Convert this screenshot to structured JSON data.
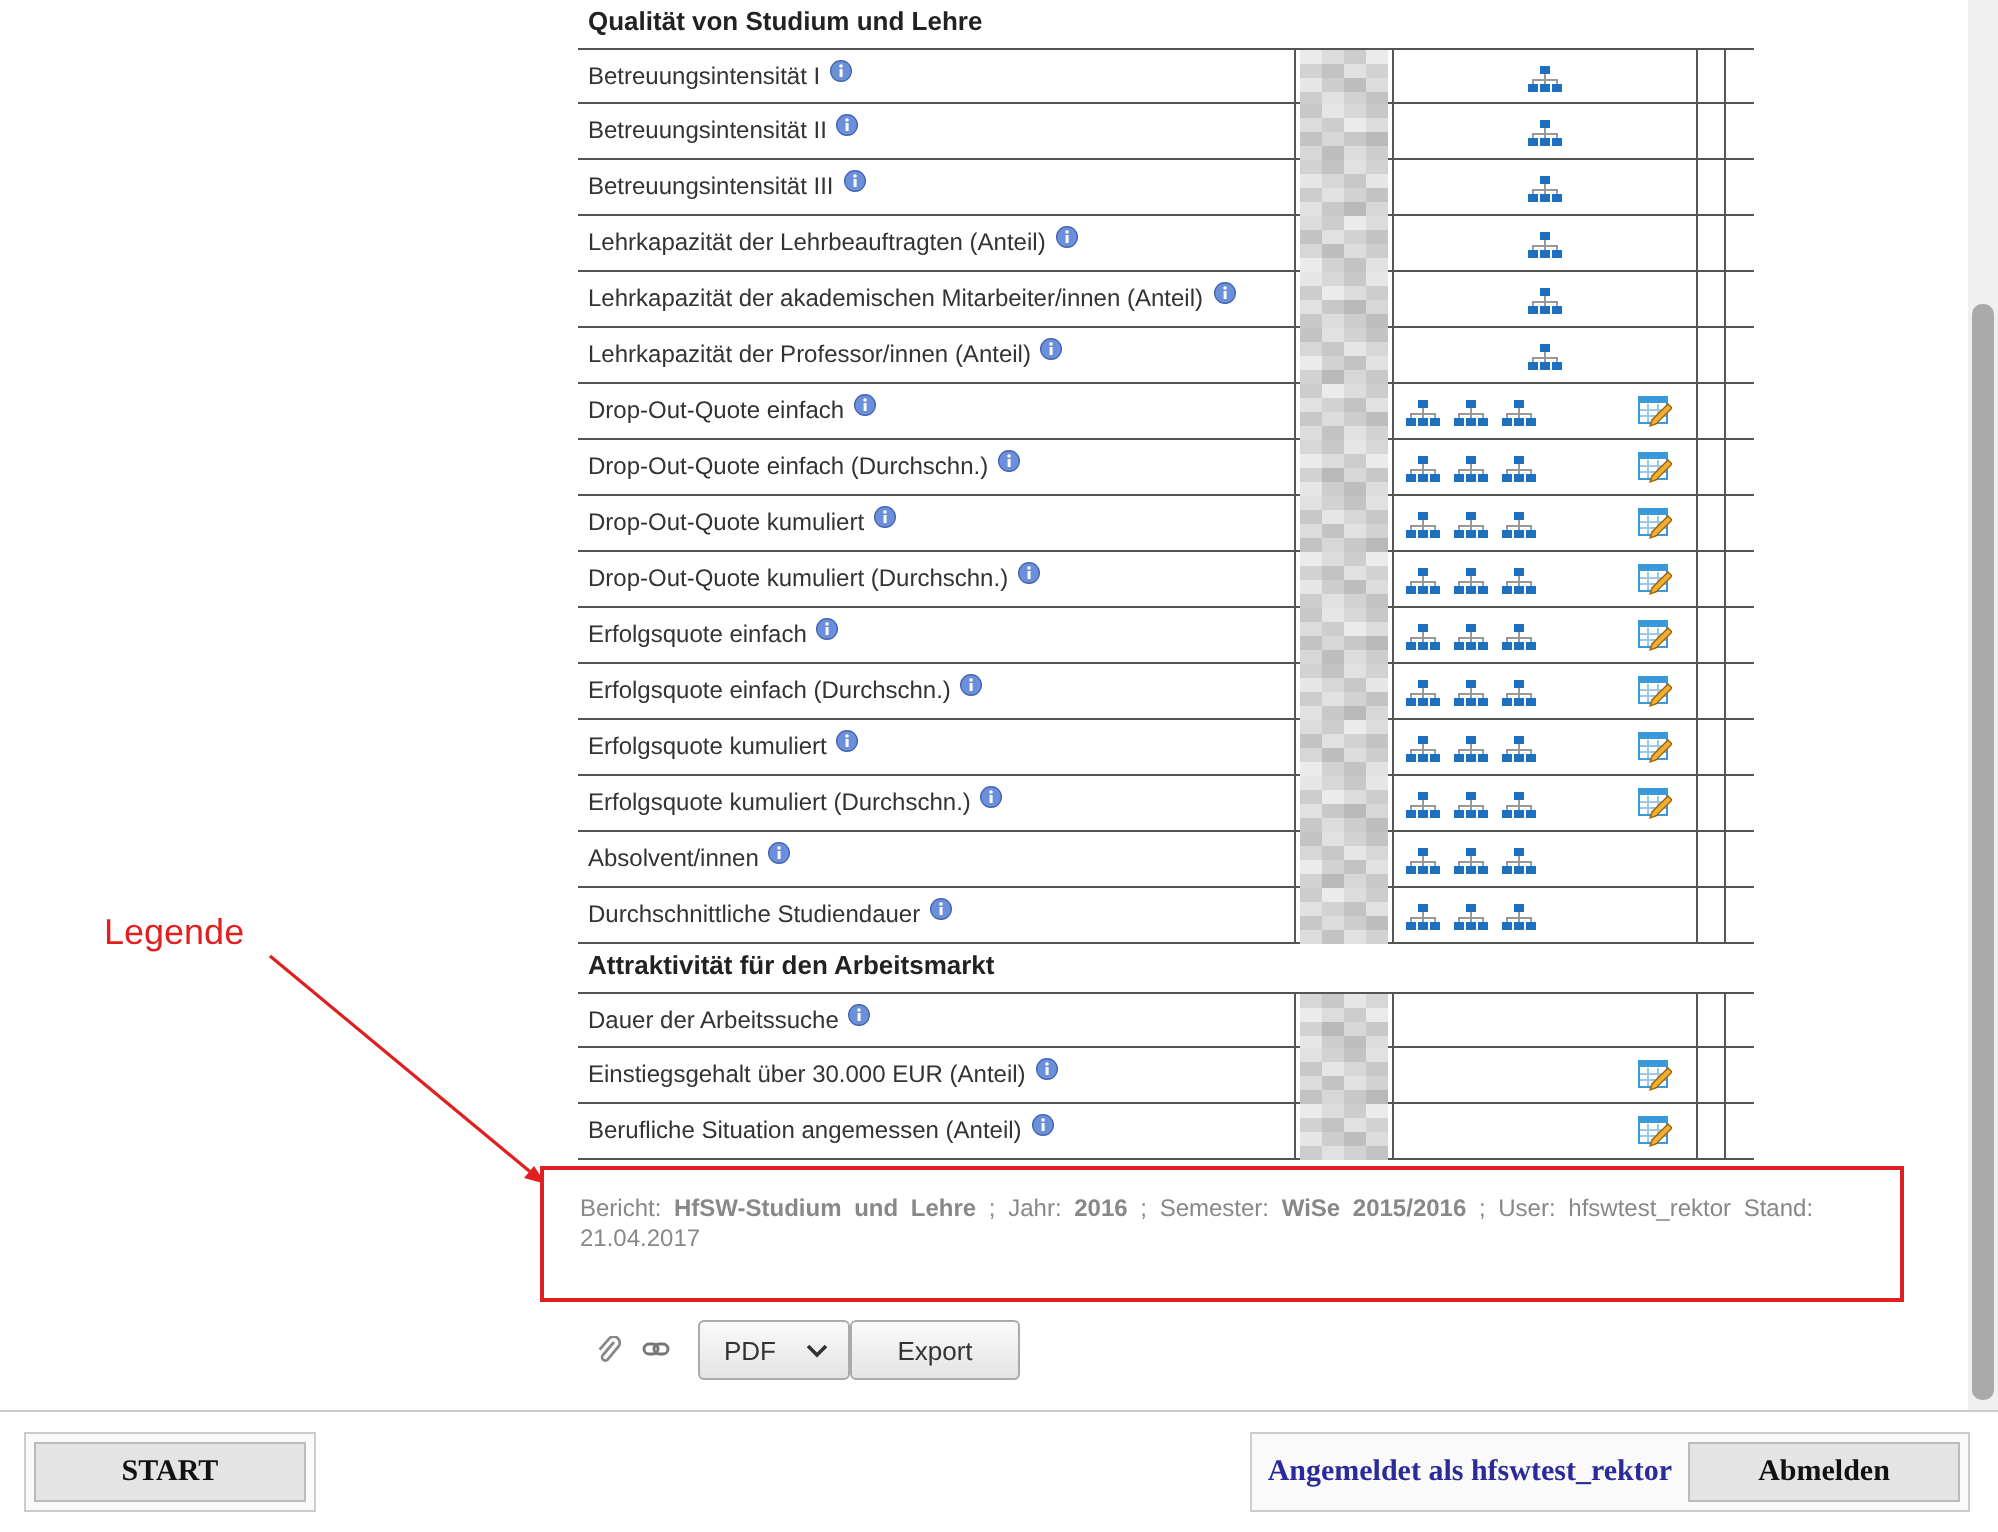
{
  "sections": [
    {
      "title": "Qualität von Studium und Lehre",
      "rows": [
        {
          "label": "Betreuungsintensität I",
          "kind": "single"
        },
        {
          "label": "Betreuungsintensität II",
          "kind": "single"
        },
        {
          "label": "Betreuungsintensität III",
          "kind": "single"
        },
        {
          "label": "Lehrkapazität der Lehrbeauftragten (Anteil)",
          "kind": "single"
        },
        {
          "label": "Lehrkapazität der akademischen Mitarbeiter/innen (Anteil)",
          "kind": "single"
        },
        {
          "label": "Lehrkapazität der Professor/innen (Anteil)",
          "kind": "single"
        },
        {
          "label": "Drop-Out-Quote einfach",
          "kind": "triple-edit"
        },
        {
          "label": "Drop-Out-Quote einfach (Durchschn.)",
          "kind": "triple-edit"
        },
        {
          "label": "Drop-Out-Quote kumuliert",
          "kind": "triple-edit"
        },
        {
          "label": "Drop-Out-Quote kumuliert (Durchschn.)",
          "kind": "triple-edit"
        },
        {
          "label": "Erfolgsquote einfach",
          "kind": "triple-edit"
        },
        {
          "label": "Erfolgsquote einfach (Durchschn.)",
          "kind": "triple-edit"
        },
        {
          "label": "Erfolgsquote kumuliert",
          "kind": "triple-edit"
        },
        {
          "label": "Erfolgsquote kumuliert (Durchschn.)",
          "kind": "triple-edit"
        },
        {
          "label": "Absolvent/innen",
          "kind": "triple"
        },
        {
          "label": "Durchschnittliche Studiendauer",
          "kind": "triple"
        }
      ]
    },
    {
      "title": "Attraktivität für den Arbeitsmarkt",
      "rows": [
        {
          "label": "Dauer der Arbeitssuche",
          "kind": "blank"
        },
        {
          "label": "Einstiegsgehalt über 30.000 EUR (Anteil)",
          "kind": "edit"
        },
        {
          "label": "Berufliche Situation angemessen (Anteil)",
          "kind": "edit"
        }
      ]
    }
  ],
  "annotation": {
    "label": "Legende"
  },
  "legend": "Bericht:  **HfSW-Studium und Lehre** ; Jahr:  **2016** ; Semester:  **WiSe 2015/2016** ; User: hfswtest_rektor  Stand: 21.04.2017",
  "export": {
    "format": "PDF",
    "button": "Export"
  },
  "footer": {
    "start": "START",
    "login": "Angemeldet als hfswtest_rektor",
    "logout": "Abmelden"
  }
}
